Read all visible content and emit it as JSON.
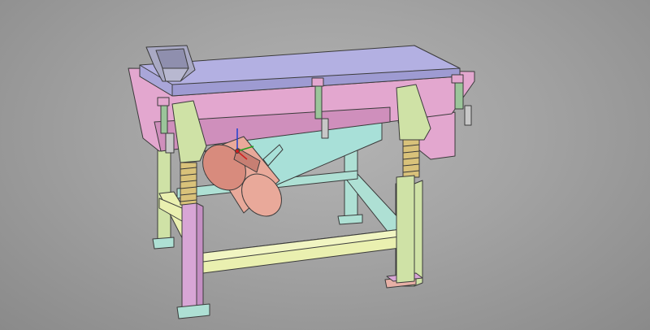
{
  "viewport": {
    "background": [
      "#b4b4b4",
      "#a3a3a3",
      "#8a8a8a"
    ]
  },
  "colors": {
    "screen_box": "#e3a7cf",
    "screen_box_dark": "#cf8fbc",
    "top_cover": "#b3b0e2",
    "top_cover_side": "#9e9bd2",
    "hopper": "#a9a9c4",
    "frame_front": "#d8a6d6",
    "frame_side": "#bfe3a9",
    "frame_rail": "#eaf0b0",
    "cross_brace": "#aee0d4",
    "bracket": "#cfe2a6",
    "spring": "#d9c27a",
    "clamp": "#9bc59a",
    "motor": "#e9a99a",
    "motor_end": "#d88b7d",
    "foot_plate": "#e7b0a6",
    "discharge_chute": "#a8e0d8",
    "axis_x": "#d02020",
    "axis_y": "#20a020",
    "axis_z": "#2040d0"
  },
  "icons": {
    "axis_gizmo": "triad-axis-icon"
  }
}
